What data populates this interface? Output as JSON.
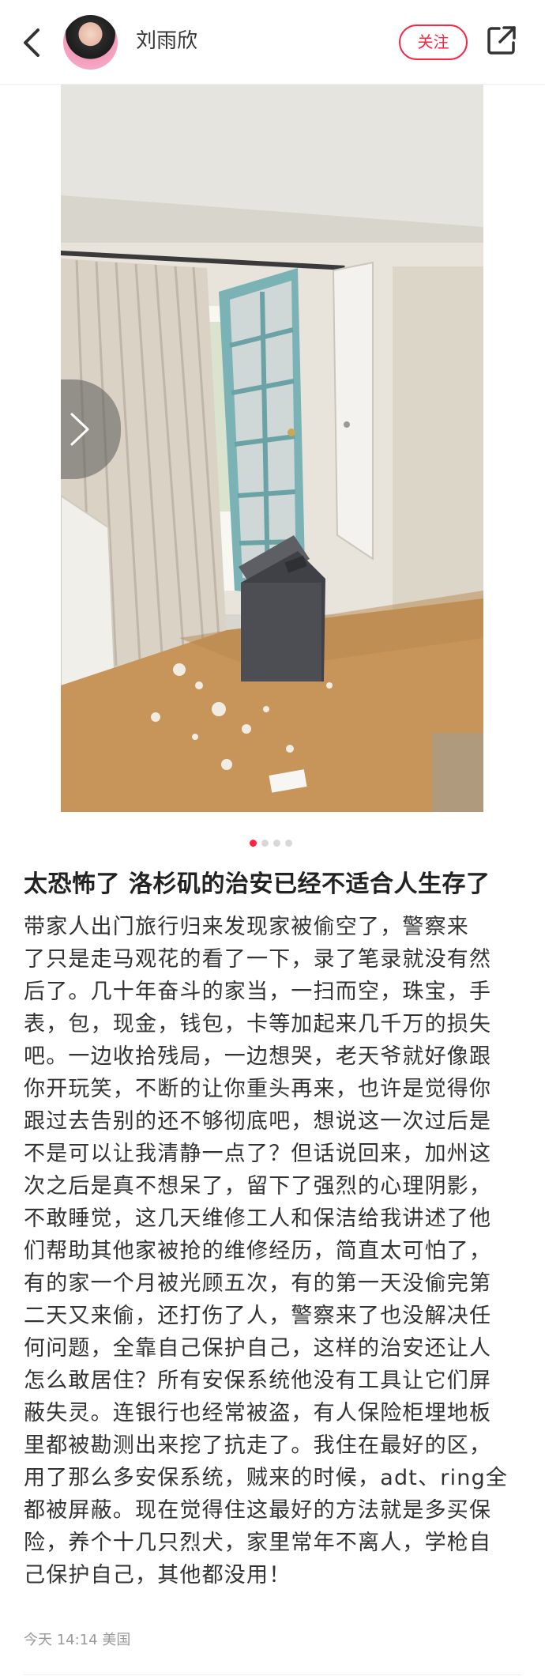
{
  "header": {
    "author_name": "刘雨欣",
    "follow_label": "关注",
    "back_icon": "chevron-left-icon",
    "share_icon": "share-icon"
  },
  "carousel": {
    "current_index": 1,
    "total": 4,
    "image_description_hidden": true
  },
  "post": {
    "title": "太恐怖了 洛杉矶的治安已经不适合人生存了",
    "body_lines": [
      "带家人出门旅行归来发现家被偷空了，警察来",
      "了只是走马观花的看了一下，录了笔录就没有然",
      "后了。几十年奋斗的家当，一扫而空，珠宝，手",
      "表，包，现金，钱包，卡等加起来几千万的损失",
      "吧。一边收拾残局，一边想哭，老天爷就好像跟",
      "你开玩笑，不断的让你重头再来，也许是觉得你",
      "跟过去告别的还不够彻底吧，想说这一次过后是",
      "不是可以让我清静一点了？但话说回来，加州这",
      "次之后是真不想呆了，留下了强烈的心理阴影，",
      "不敢睡觉，这几天维修工人和保洁给我讲述了他",
      "们帮助其他家被抢的维修经历，简直太可怕了，",
      "有的家一个月被光顾五次，有的第一天没偷完第",
      "二天又来偷，还打伤了人，警察来了也没解决任",
      "何问题，全靠自己保护自己，这样的治安还让人",
      "怎么敢居住？所有安保系统他没有工具让它们屏",
      "蔽失灵。连银行也经常被盗，有人保险柜埋地板",
      "里都被勘测出来挖了抗走了。我住在最好的区，",
      "用了那么多安保系统，贼来的时候，adt、ring全",
      "都被屏蔽。现在觉得住这最好的方法就是多买保",
      "险，养个十几只烈犬，家里常年不离人，学枪自",
      "己保护自己，其他都没用！"
    ],
    "meta": "今天 14:14 美国"
  },
  "colors": {
    "accent": "#ff2442",
    "text": "#333333",
    "muted": "#999999"
  }
}
